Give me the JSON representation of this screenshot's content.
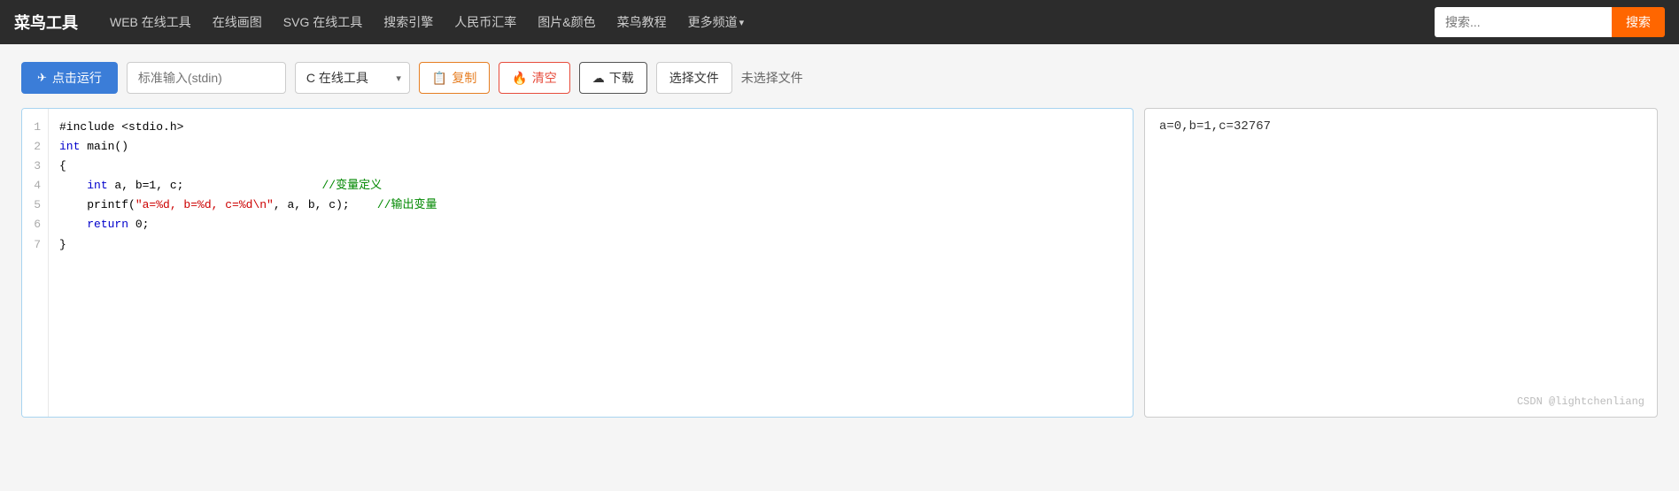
{
  "navbar": {
    "brand": "菜鸟工具",
    "links": [
      {
        "label": "WEB 在线工具",
        "arrow": false
      },
      {
        "label": "在线画图",
        "arrow": false
      },
      {
        "label": "SVG 在线工具",
        "arrow": false
      },
      {
        "label": "搜索引擎",
        "arrow": false
      },
      {
        "label": "人民币汇率",
        "arrow": false
      },
      {
        "label": "图片&颜色",
        "arrow": false
      },
      {
        "label": "菜鸟教程",
        "arrow": false
      },
      {
        "label": "更多频道",
        "arrow": true
      }
    ],
    "search_placeholder": "搜索...",
    "search_button": "搜索"
  },
  "toolbar": {
    "run_label": "点击运行",
    "stdin_placeholder": "标准输入(stdin)",
    "lang_label": "C 在线工具",
    "copy_label": "复制",
    "clear_label": "清空",
    "download_label": "下载",
    "file_button": "选择文件",
    "file_status": "未选择文件"
  },
  "editor": {
    "lines": [
      "1",
      "2",
      "3",
      "4",
      "5",
      "6",
      "7"
    ],
    "code_lines": [
      {
        "tokens": [
          {
            "t": "plain",
            "v": "#include <stdio.h>"
          }
        ]
      },
      {
        "tokens": [
          {
            "t": "kw",
            "v": "int"
          },
          {
            "t": "plain",
            "v": " main()"
          }
        ]
      },
      {
        "tokens": [
          {
            "t": "plain",
            "v": "{"
          }
        ]
      },
      {
        "tokens": [
          {
            "t": "plain",
            "v": "    "
          },
          {
            "t": "kw",
            "v": "int"
          },
          {
            "t": "plain",
            "v": " a, b=1, c;"
          },
          {
            "t": "plain",
            "v": "                    "
          },
          {
            "t": "cmt",
            "v": "//变量定义"
          }
        ]
      },
      {
        "tokens": [
          {
            "t": "plain",
            "v": "    "
          },
          {
            "t": "plain",
            "v": "printf("
          },
          {
            "t": "str",
            "v": "\"a=%d, b=%d, c=%d\\n\""
          },
          {
            "t": "plain",
            "v": ", a, b, c);"
          },
          {
            "t": "plain",
            "v": "    "
          },
          {
            "t": "cmt",
            "v": "//输出变量"
          }
        ]
      },
      {
        "tokens": [
          {
            "t": "plain",
            "v": "    "
          },
          {
            "t": "kw",
            "v": "return"
          },
          {
            "t": "plain",
            "v": " 0;"
          }
        ]
      },
      {
        "tokens": [
          {
            "t": "plain",
            "v": "}"
          }
        ]
      }
    ]
  },
  "output": {
    "text": "a=0,b=1,c=32767",
    "watermark": "CSDN @lightchenliang"
  }
}
